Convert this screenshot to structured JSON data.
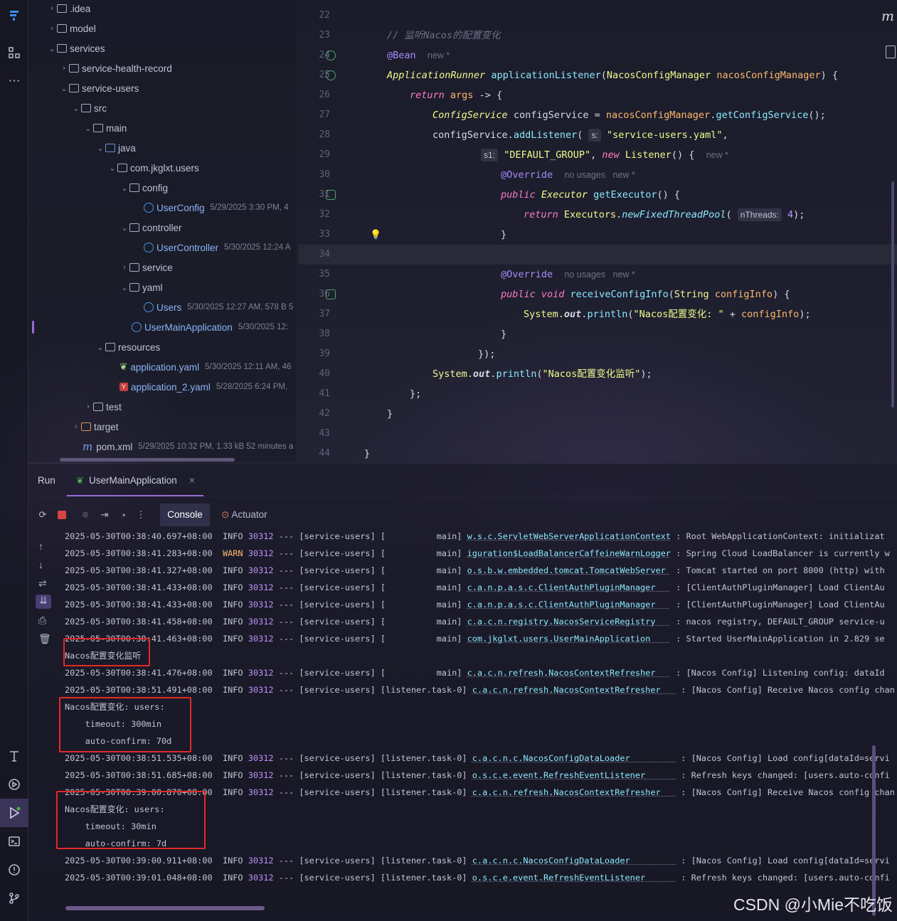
{
  "activity_bar": {
    "top_icons": [
      "logo-icon",
      "structure-icon",
      "more-icon"
    ],
    "bottom_icons": [
      "build-icon",
      "services-icon",
      "run-icon",
      "terminal-icon",
      "problems-icon",
      "git-icon"
    ]
  },
  "project_tree": [
    {
      "label": ".idea",
      "meta": ""
    },
    {
      "label": "model",
      "meta": ""
    },
    {
      "label": "services",
      "meta": ""
    },
    {
      "label": "service-health-record",
      "meta": ""
    },
    {
      "label": "service-users",
      "meta": ""
    },
    {
      "label": "src",
      "meta": ""
    },
    {
      "label": "main",
      "meta": ""
    },
    {
      "label": "java",
      "meta": ""
    },
    {
      "label": "com.jkglxt.users",
      "meta": ""
    },
    {
      "label": "config",
      "meta": ""
    },
    {
      "label": "UserConfig",
      "meta": "5/29/2025 3:30 PM, 4"
    },
    {
      "label": "controller",
      "meta": ""
    },
    {
      "label": "UserController",
      "meta": "5/30/2025 12:24 A"
    },
    {
      "label": "service",
      "meta": ""
    },
    {
      "label": "yaml",
      "meta": ""
    },
    {
      "label": "Users",
      "meta": "5/30/2025 12:27 AM, 578 B 5"
    },
    {
      "label": "UserMainApplication",
      "meta": "5/30/2025 12:"
    },
    {
      "label": "resources",
      "meta": ""
    },
    {
      "label": "application.yaml",
      "meta": "5/30/2025 12:11 AM, 46"
    },
    {
      "label": "application_2.yaml",
      "meta": "5/28/2025 6:24 PM, "
    },
    {
      "label": "test",
      "meta": ""
    },
    {
      "label": "target",
      "meta": ""
    },
    {
      "label": "pom.xml",
      "meta": "5/29/2025 10:32 PM, 1.33 kB 52 minutes a"
    }
  ],
  "editor": {
    "line_numbers": [
      "22",
      "23",
      "24",
      "25",
      "26",
      "27",
      "28",
      "29",
      "30",
      "31",
      "32",
      "33",
      "34",
      "35",
      "36",
      "37",
      "38",
      "39",
      "40",
      "41",
      "42",
      "43",
      "44"
    ],
    "lines": {
      "l23": "// 监听Nacos的配置变化",
      "l24_ann": "@Bean",
      "l24_hint": "new *",
      "l25_type": "ApplicationRunner",
      "l25_fn": "applicationListener",
      "l25_ptype": "NacosConfigManager",
      "l25_param": "nacosConfigManager",
      "l26_kw": "return",
      "l26_args": "args",
      "l27_type": "ConfigService",
      "l27_var": "configService",
      "l27_call": "nacosConfigManager",
      "l27_fn": "getConfigService",
      "l28_var": "configService",
      "l28_fn": "addListener",
      "l28_hint": "s:",
      "l28_str": "\"service-users.yaml\"",
      "l29_hint": "s1:",
      "l29_str": "\"DEFAULT_GROUP\"",
      "l29_kw": "new",
      "l29_type": "Listener",
      "l29_hint2": "new *",
      "l30_ann": "@Override",
      "l30_hint": "no usages   new *",
      "l31_kw": "public",
      "l31_type": "Executor",
      "l31_fn": "getExecutor",
      "l32_kw": "return",
      "l32_type": "Executors",
      "l32_fn": "newFixedThreadPool",
      "l32_hint": "nThreads:",
      "l32_num": "4",
      "l35_ann": "@Override",
      "l35_hint": "no usages   new *",
      "l36_kw": "public void",
      "l36_fn": "receiveConfigInfo",
      "l36_ptype": "String",
      "l36_param": "configInfo",
      "l37_sys": "System.",
      "l37_out": "out",
      "l37_fn": "println",
      "l37_str": "\"Nacos配置变化: \"",
      "l37_param": "configInfo",
      "l40_sys": "System.",
      "l40_out": "out",
      "l40_fn": "println",
      "l40_str": "\"Nacos配置变化监听\""
    }
  },
  "run_panel": {
    "title": "Run",
    "tab_label": "UserMainApplication",
    "console_tab": "Console",
    "actuator_tab": "Actuator",
    "logs": [
      {
        "ts": "2025-05-30T00:38:40.697+08:00",
        "lvl": "INFO",
        "pid": "30312",
        "th": "[service-users] [          main]",
        "cls": "w.s.c.ServletWebServerApplicationContext",
        "msg": ": Root WebApplicationContext: initializat"
      },
      {
        "ts": "2025-05-30T00:38:41.283+08:00",
        "lvl": "WARN",
        "pid": "30312",
        "th": "[service-users] [          main]",
        "cls": "iguration$LoadBalancerCaffeineWarnLogger",
        "msg": ": Spring Cloud LoadBalancer is currently w"
      },
      {
        "ts": "2025-05-30T00:38:41.327+08:00",
        "lvl": "INFO",
        "pid": "30312",
        "th": "[service-users] [          main]",
        "cls": "o.s.b.w.embedded.tomcat.TomcatWebServer ",
        "msg": ": Tomcat started on port 8000 (http) with"
      },
      {
        "ts": "2025-05-30T00:38:41.433+08:00",
        "lvl": "INFO",
        "pid": "30312",
        "th": "[service-users] [          main]",
        "cls": "c.a.n.p.a.s.c.ClientAuthPluginManager   ",
        "msg": ": [ClientAuthPluginManager] Load ClientAu"
      },
      {
        "ts": "2025-05-30T00:38:41.433+08:00",
        "lvl": "INFO",
        "pid": "30312",
        "th": "[service-users] [          main]",
        "cls": "c.a.n.p.a.s.c.ClientAuthPluginManager   ",
        "msg": ": [ClientAuthPluginManager] Load ClientAu"
      },
      {
        "ts": "2025-05-30T00:38:41.458+08:00",
        "lvl": "INFO",
        "pid": "30312",
        "th": "[service-users] [          main]",
        "cls": "c.a.c.n.registry.NacosServiceRegistry   ",
        "msg": ": nacos registry, DEFAULT_GROUP service-u"
      },
      {
        "ts": "2025-05-30T00:38:41.463+08:00",
        "lvl": "INFO",
        "pid": "30312",
        "th": "[service-users] [          main]",
        "cls": "com.jkglxt.users.UserMainApplication    ",
        "msg": ": Started UserMainApplication in 2.829 se"
      },
      {
        "plain": "Nacos配置变化监听"
      },
      {
        "ts": "2025-05-30T00:38:41.476+08:00",
        "lvl": "INFO",
        "pid": "30312",
        "th": "[service-users] [          main]",
        "cls": "c.a.c.n.refresh.NacosContextRefresher   ",
        "msg": ": [Nacos Config] Listening config: dataId"
      },
      {
        "ts": "2025-05-30T00:38:51.491+08:00",
        "lvl": "INFO",
        "pid": "30312",
        "th": "[service-users] [listener.task-0]",
        "cls": "c.a.c.n.refresh.NacosContextRefresher   ",
        "msg": ": [Nacos Config] Receive Nacos config chan"
      },
      {
        "plain": "Nacos配置变化: users:"
      },
      {
        "plain": "    timeout: 300min"
      },
      {
        "plain": "    auto-confirm: 70d"
      },
      {
        "ts": "2025-05-30T00:38:51.535+08:00",
        "lvl": "INFO",
        "pid": "30312",
        "th": "[service-users] [listener.task-0]",
        "cls": "c.a.c.n.c.NacosConfigDataLoader         ",
        "msg": ": [Nacos Config] Load config[dataId=servi"
      },
      {
        "ts": "2025-05-30T00:38:51.685+08:00",
        "lvl": "INFO",
        "pid": "30312",
        "th": "[service-users] [listener.task-0]",
        "cls": "o.s.c.e.event.RefreshEventListener      ",
        "msg": ": Refresh keys changed: [users.auto-confi"
      },
      {
        "ts": "2025-05-30T00:39:00.870+08:00",
        "lvl": "INFO",
        "pid": "30312",
        "th": "[service-users] [listener.task-0]",
        "cls": "c.a.c.n.refresh.NacosContextRefresher   ",
        "msg": ": [Nacos Config] Receive Nacos config chan"
      },
      {
        "plain": "Nacos配置变化: users:"
      },
      {
        "plain": "    timeout: 30min"
      },
      {
        "plain": "    auto-confirm: 7d"
      },
      {
        "ts": "2025-05-30T00:39:00.911+08:00",
        "lvl": "INFO",
        "pid": "30312",
        "th": "[service-users] [listener.task-0]",
        "cls": "c.a.c.n.c.NacosConfigDataLoader         ",
        "msg": ": [Nacos Config] Load config[dataId=servi"
      },
      {
        "ts": "2025-05-30T00:39:01.048+08:00",
        "lvl": "INFO",
        "pid": "30312",
        "th": "[service-users] [listener.task-0]",
        "cls": "o.s.c.e.event.RefreshEventListener      ",
        "msg": ": Refresh keys changed: [users.auto-confi"
      }
    ]
  },
  "watermark": "CSDN @小Mie不吃饭",
  "top_right_glyph": "m",
  "colors": {
    "highlight_box": "#e02a2a",
    "accent": "#9b6bd8"
  }
}
